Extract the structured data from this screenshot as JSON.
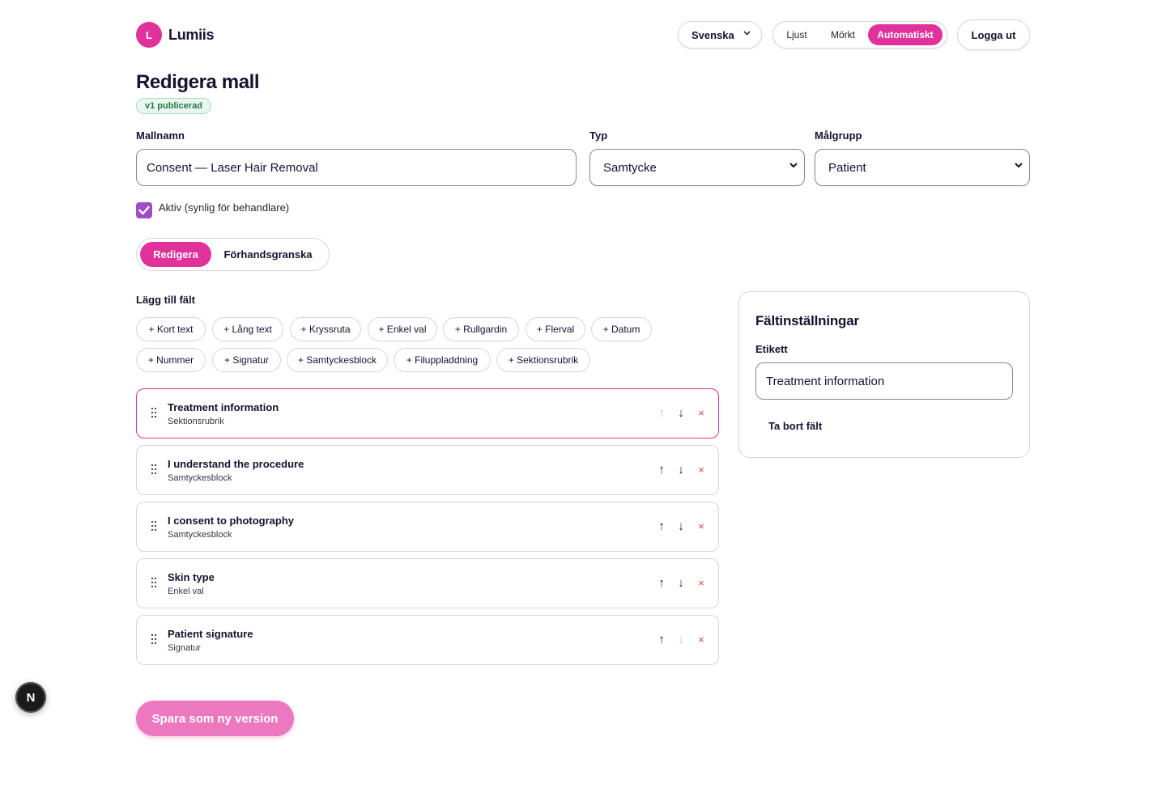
{
  "brand": {
    "initial": "L",
    "name": "Lumiis"
  },
  "header": {
    "language": "Svenska",
    "theme_options": [
      "Ljust",
      "Mörkt",
      "Automatiskt"
    ],
    "theme_active": "Automatiskt",
    "logout": "Logga ut"
  },
  "page": {
    "title": "Redigera mall",
    "version_badge": "v1 publicerad"
  },
  "form": {
    "name_label": "Mallnamn",
    "name_value": "Consent — Laser Hair Removal",
    "type_label": "Typ",
    "type_value": "Samtycke",
    "audience_label": "Målgrupp",
    "audience_value": "Patient",
    "active_checked": true,
    "active_label": "Aktiv (synlig för behandlare)"
  },
  "tabs": {
    "edit": "Redigera",
    "preview": "Förhandsgranska",
    "active": "Redigera"
  },
  "add_fields": {
    "label": "Lägg till fält",
    "row1": [
      "+ Kort text",
      "+ Lång text",
      "+ Kryssruta",
      "+ Enkel val",
      "+ Rullgardin",
      "+ Flerval",
      "+ Datum"
    ],
    "row2": [
      "+ Nummer",
      "+ Signatur",
      "+ Samtyckesblock",
      "+ Filuppladdning",
      "+ Sektionsrubrik"
    ]
  },
  "fields": [
    {
      "title": "Treatment information",
      "type": "Sektionsrubrik",
      "selected": true,
      "up_disabled": true,
      "down_disabled": false
    },
    {
      "title": "I understand the procedure",
      "type": "Samtyckesblock",
      "selected": false,
      "up_disabled": false,
      "down_disabled": false
    },
    {
      "title": "I consent to photography",
      "type": "Samtyckesblock",
      "selected": false,
      "up_disabled": false,
      "down_disabled": false
    },
    {
      "title": "Skin type",
      "type": "Enkel val",
      "selected": false,
      "up_disabled": false,
      "down_disabled": false
    },
    {
      "title": "Patient signature",
      "type": "Signatur",
      "selected": false,
      "up_disabled": false,
      "down_disabled": true
    }
  ],
  "field_controls": {
    "up": "↑",
    "down": "↓",
    "delete": "×"
  },
  "settings": {
    "title": "Fältinställningar",
    "label_label": "Etikett",
    "label_value": "Treatment information",
    "delete_field": "Ta bort fält"
  },
  "save_button": "Spara som ny version",
  "dev_badge": "N",
  "colors": {
    "accent": "#e0329a",
    "accent_light": "#ec79bf",
    "checkbox": "#a04cc4",
    "delete": "#d94a3a",
    "badge_green": "#1f7a45"
  }
}
